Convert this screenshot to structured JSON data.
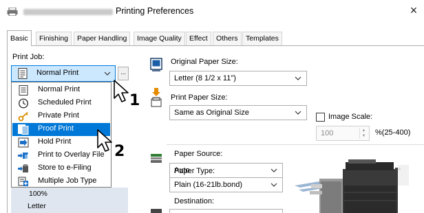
{
  "window": {
    "title": "Printing Preferences",
    "close_symbol": "×"
  },
  "tabs": [
    {
      "label": "Basic",
      "active": true
    },
    {
      "label": "Finishing"
    },
    {
      "label": "Paper Handling"
    },
    {
      "label": "Image Quality"
    },
    {
      "label": "Effect"
    },
    {
      "label": "Others"
    },
    {
      "label": "Templates"
    }
  ],
  "print_job": {
    "label": "Print Job:",
    "selected": "Normal Print",
    "more_button": "...",
    "options": [
      {
        "label": "Normal Print",
        "icon": "normal-print-icon"
      },
      {
        "label": "Scheduled Print",
        "icon": "scheduled-print-icon"
      },
      {
        "label": "Private Print",
        "icon": "private-print-icon"
      },
      {
        "label": "Proof Print",
        "icon": "proof-print-icon",
        "highlighted": true
      },
      {
        "label": "Hold Print",
        "icon": "hold-print-icon"
      },
      {
        "label": "Print to Overlay File",
        "icon": "overlay-file-icon"
      },
      {
        "label": "Store to e-Filing",
        "icon": "e-filing-icon"
      },
      {
        "label": "Multiple Job Type",
        "icon": "multiple-job-icon"
      }
    ],
    "summary": {
      "zoom": "100%",
      "paper": "Letter"
    }
  },
  "original_paper_size": {
    "label": "Original Paper Size:",
    "value": "Letter (8 1/2 x 11\")"
  },
  "print_paper_size": {
    "label": "Print Paper Size:",
    "value": "Same as Original Size"
  },
  "image_scale": {
    "label": "Image Scale:",
    "value": "100",
    "range": "%(25-400)",
    "checked": false
  },
  "paper_source": {
    "label": "Paper Source:",
    "value": "Auto"
  },
  "paper_type": {
    "label": "Paper Type:",
    "value": "Plain (16-21lb.bond)"
  },
  "destination": {
    "label": "Destination:"
  },
  "callouts": {
    "first": "1",
    "second": "2"
  },
  "colors": {
    "accent": "#0078d7",
    "selection_bg": "#cce8ff",
    "printer_icon": "#e58b00"
  }
}
